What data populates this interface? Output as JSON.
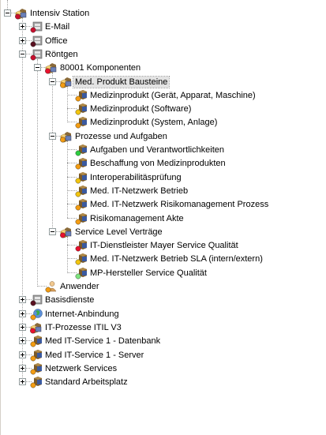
{
  "tree": {
    "nodes": [
      {
        "label": "Intensiv Station",
        "depth": 0,
        "toggle": "minus",
        "icon": "folder-component-icon",
        "status": "#c8102e"
      },
      {
        "label": "E-Mail",
        "depth": 1,
        "toggle": "plus",
        "icon": "server-icon",
        "status": "#c8102e"
      },
      {
        "label": "Office",
        "depth": 1,
        "toggle": "plus",
        "icon": "server-icon",
        "status": "#5a1020"
      },
      {
        "label": "Röntgen",
        "depth": 1,
        "toggle": "minus",
        "icon": "server-icon",
        "status": "#c8102e"
      },
      {
        "label": "80001 Komponenten",
        "depth": 2,
        "toggle": "minus",
        "icon": "folder-component-icon",
        "status": "#e8112d"
      },
      {
        "label": "Med. Produkt Bausteine",
        "depth": 3,
        "toggle": "minus",
        "icon": "folder-component-icon",
        "status": "#f39c12",
        "selected": true
      },
      {
        "label": "Medizinprodukt (Gerät, Apparat, Maschine)",
        "depth": 4,
        "toggle": "none",
        "icon": "component-icon",
        "status": "#f39c12"
      },
      {
        "label": "Medizinprodukt (Software)",
        "depth": 4,
        "toggle": "none",
        "icon": "component-icon",
        "status": "#f1c40f"
      },
      {
        "label": "Medizinprodukt (System, Anlage)",
        "depth": 4,
        "toggle": "none",
        "icon": "component-icon",
        "status": "#f39c12"
      },
      {
        "label": "Prozesse und Aufgaben",
        "depth": 3,
        "toggle": "minus",
        "icon": "folder-component-icon",
        "status": "#f39c12"
      },
      {
        "label": "Aufgaben und Verantwortlichkeiten",
        "depth": 4,
        "toggle": "none",
        "icon": "component-icon",
        "status": "#2ecc40"
      },
      {
        "label": "Beschaffung von Medizinprodukten",
        "depth": 4,
        "toggle": "none",
        "icon": "component-icon",
        "status": "#f39c12"
      },
      {
        "label": "Interoperabilitäsprüfung",
        "depth": 4,
        "toggle": "none",
        "icon": "component-icon",
        "status": "#f1c40f"
      },
      {
        "label": "Med. IT-Netzwerk Betrieb",
        "depth": 4,
        "toggle": "none",
        "icon": "component-icon",
        "status": "#f1c40f"
      },
      {
        "label": "Med. IT-Netzwerk  Risikomanagement Prozess",
        "depth": 4,
        "toggle": "none",
        "icon": "component-icon",
        "status": "#f39c12"
      },
      {
        "label": "Risikomanagement Akte",
        "depth": 4,
        "toggle": "none",
        "icon": "component-icon",
        "status": "#f39c12"
      },
      {
        "label": "Service Level Verträge",
        "depth": 3,
        "toggle": "minus",
        "icon": "folder-component-icon",
        "status": "#e8112d"
      },
      {
        "label": "IT-Dienstleister Mayer Service Qualität",
        "depth": 4,
        "toggle": "none",
        "icon": "component-icon",
        "status": "#e8112d"
      },
      {
        "label": "Med. IT-Netzwerk Betrieb SLA (intern/extern)",
        "depth": 4,
        "toggle": "none",
        "icon": "component-icon",
        "status": "#f1c40f"
      },
      {
        "label": "MP-Hersteller Service Qualität",
        "depth": 4,
        "toggle": "none",
        "icon": "component-icon",
        "status": "#7ee37e"
      },
      {
        "label": "Anwender",
        "depth": 2,
        "toggle": "none",
        "icon": "user-icon",
        "status": "#f39c12"
      },
      {
        "label": "Basisdienste",
        "depth": 1,
        "toggle": "plus",
        "icon": "server-icon",
        "status": "#5a1020"
      },
      {
        "label": "Internet-Anbindung",
        "depth": 1,
        "toggle": "plus",
        "icon": "globe-icon",
        "status": "#f39c12"
      },
      {
        "label": "IT-Prozesse ITIL V3",
        "depth": 1,
        "toggle": "plus",
        "icon": "folder-component-icon",
        "status": "#e8112d"
      },
      {
        "label": "Med IT-Service 1 - Datenbank",
        "depth": 1,
        "toggle": "plus",
        "icon": "component-icon",
        "status": "#f39c12"
      },
      {
        "label": "Med IT-Service 1 - Server",
        "depth": 1,
        "toggle": "plus",
        "icon": "component-icon",
        "status": "#f39c12"
      },
      {
        "label": "Netzwerk Services",
        "depth": 1,
        "toggle": "plus",
        "icon": "component-icon",
        "status": "#f39c12"
      },
      {
        "label": "Standard Arbeitsplatz",
        "depth": 1,
        "toggle": "plus",
        "icon": "component-icon",
        "status": "#f39c12"
      }
    ]
  }
}
